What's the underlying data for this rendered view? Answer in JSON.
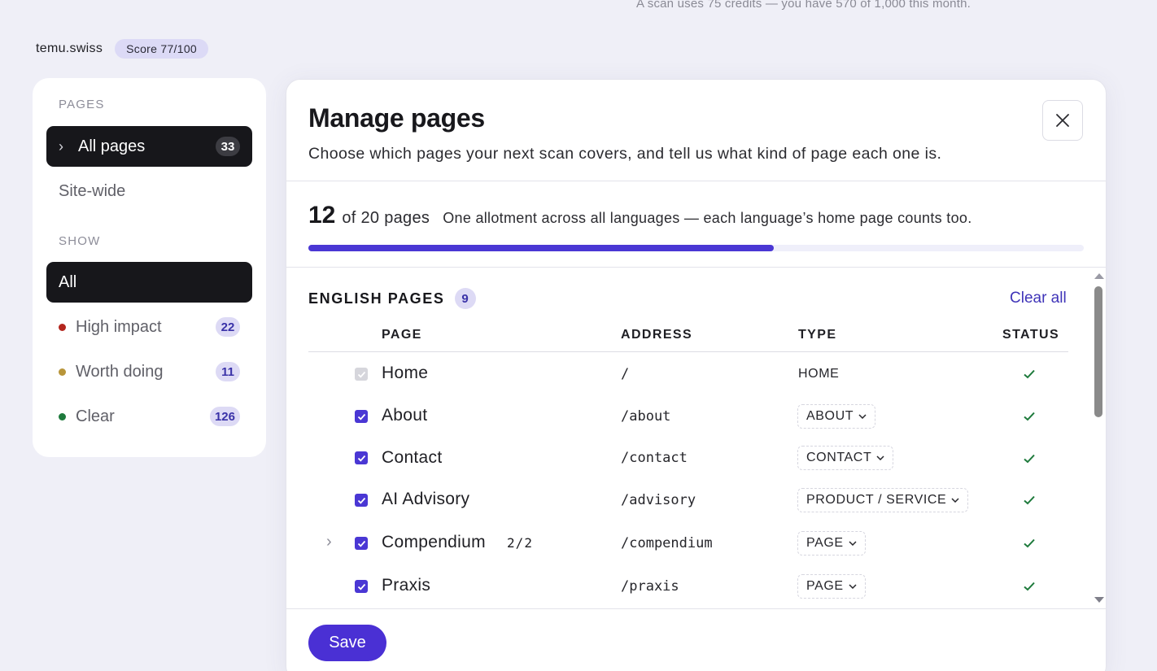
{
  "credits_note": "A scan uses 75 credits — you have 570 of 1,000 this month.",
  "site": {
    "name": "temu.swiss",
    "score": "Score 77/100"
  },
  "sidebar": {
    "pages_heading": "PAGES",
    "pages": [
      {
        "label": "All pages",
        "count": "33",
        "active": true
      },
      {
        "label": "Site-wide"
      }
    ],
    "show_heading": "SHOW",
    "filters": [
      {
        "label": "All",
        "active": true
      },
      {
        "label": "High impact",
        "count": "22",
        "dot_color": "#b3261e"
      },
      {
        "label": "Worth doing",
        "count": "11",
        "dot_color": "#b8953a"
      },
      {
        "label": "Clear",
        "count": "126",
        "dot_color": "#1e7a3c"
      }
    ]
  },
  "modal": {
    "title": "Manage pages",
    "subtitle": "Choose which pages your next scan covers, and tell us what kind of page each one is.",
    "quota": {
      "used": "12",
      "of_label": "of 20 pages",
      "note": "One allotment across all languages — each language’s home page counts too.",
      "progress": 0.6
    },
    "section": {
      "title": "ENGLISH PAGES",
      "count": "9",
      "clear_all": "Clear all"
    },
    "columns": {
      "page": "PAGE",
      "address": "ADDRESS",
      "type": "TYPE",
      "status": "STATUS"
    },
    "rows": [
      {
        "name": "Home",
        "address": "/",
        "type": "HOME",
        "editable": false,
        "checked": true,
        "disabled": true
      },
      {
        "name": "About",
        "address": "/about",
        "type": "ABOUT",
        "editable": true,
        "checked": true
      },
      {
        "name": "Contact",
        "address": "/contact",
        "type": "CONTACT",
        "editable": true,
        "checked": true
      },
      {
        "name": "AI Advisory",
        "address": "/advisory",
        "type": "PRODUCT / SERVICE",
        "editable": true,
        "checked": true
      },
      {
        "name": "Compendium",
        "subcount": "2/2",
        "address": "/compendium",
        "type": "PAGE",
        "editable": true,
        "checked": true,
        "expandable": true
      },
      {
        "name": "Praxis",
        "address": "/praxis",
        "type": "PAGE",
        "editable": true,
        "checked": true
      }
    ],
    "save_label": "Save"
  },
  "colors": {
    "accent": "#4a37d4",
    "check_green": "#1e7a3c"
  }
}
